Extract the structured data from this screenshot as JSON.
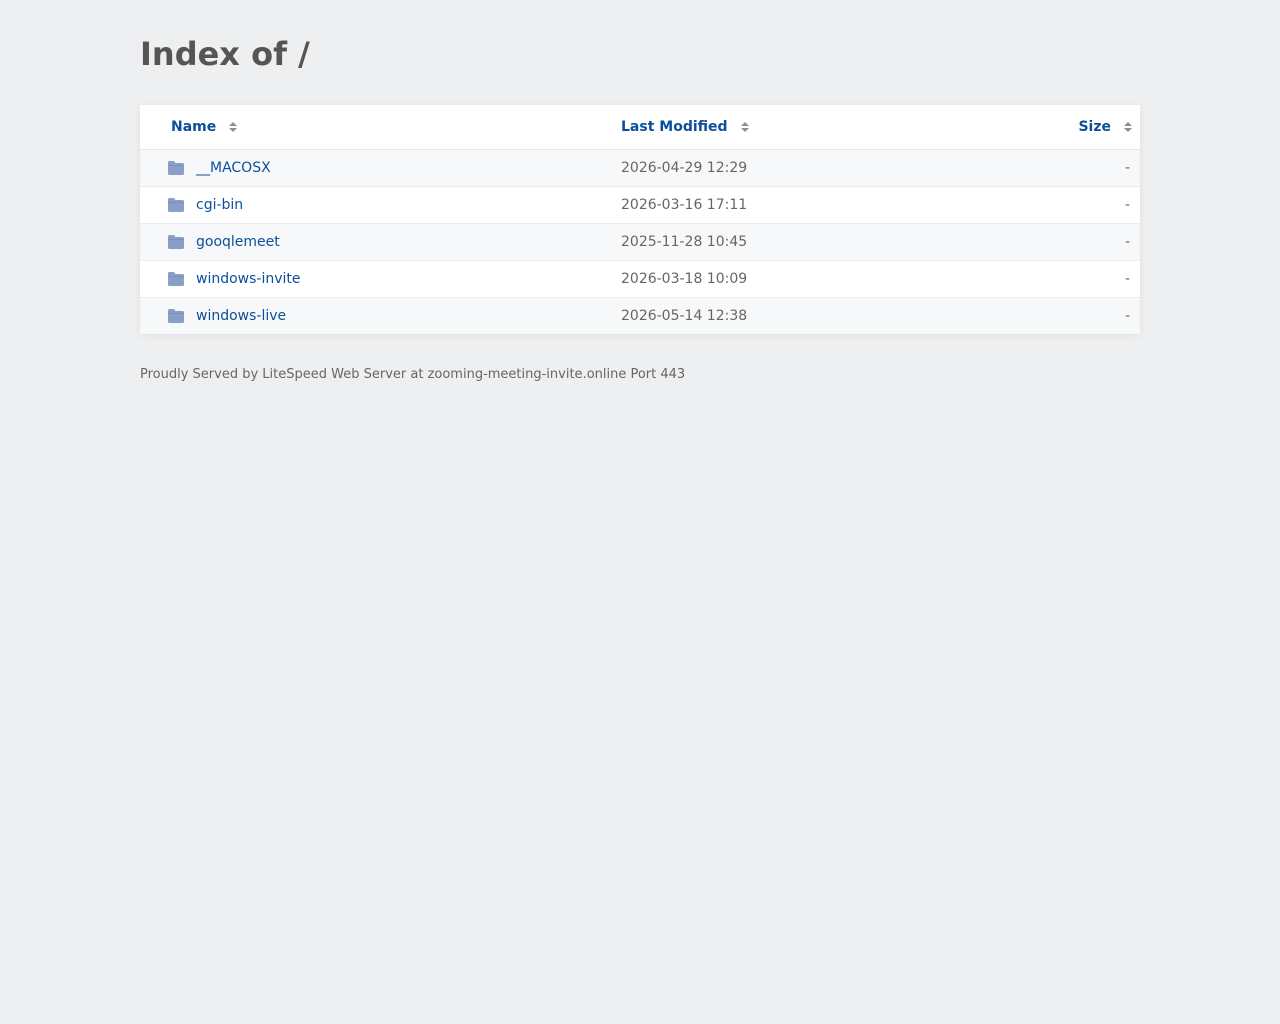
{
  "page": {
    "title": "Index of /"
  },
  "table": {
    "headers": {
      "name": "Name",
      "last_modified": "Last Modified",
      "size": "Size"
    },
    "rows": [
      {
        "name": "__MACOSX",
        "modified": "2026-04-29 12:29",
        "size": "-"
      },
      {
        "name": "cgi-bin",
        "modified": "2026-03-16 17:11",
        "size": "-"
      },
      {
        "name": "gooqlemeet",
        "modified": "2025-11-28 10:45",
        "size": "-"
      },
      {
        "name": "windows-invite",
        "modified": "2026-03-18 10:09",
        "size": "-"
      },
      {
        "name": "windows-live",
        "modified": "2026-05-14 12:38",
        "size": "-"
      }
    ]
  },
  "footer": {
    "text": "Proudly Served by LiteSpeed Web Server at zooming-meeting-invite.online Port 443"
  },
  "colors": {
    "link": "#0b4f9c",
    "folder": "#8a9fc7",
    "background": "#eeeff0"
  },
  "icons": {
    "folder": "folder-icon",
    "sort": "sort-icon"
  }
}
